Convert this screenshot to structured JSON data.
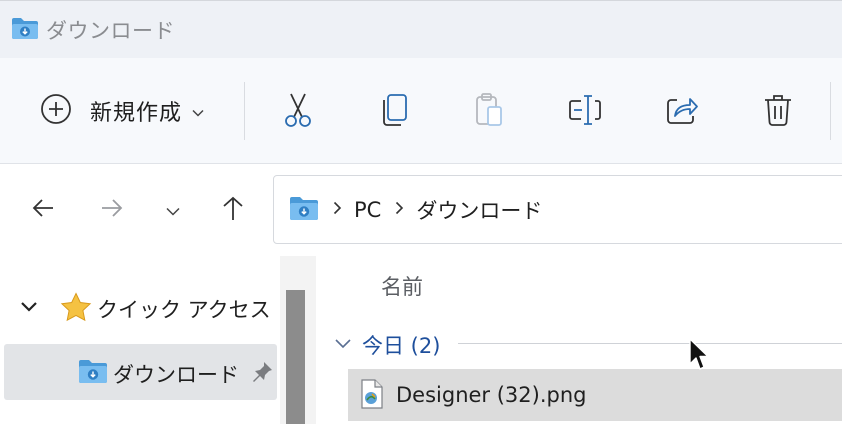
{
  "window": {
    "title": "ダウンロード",
    "icon": "downloads-folder-icon"
  },
  "commandbar": {
    "new_label": "新規作成",
    "tools": [
      {
        "name": "cut",
        "icon": "scissors-icon",
        "enabled": true
      },
      {
        "name": "copy",
        "icon": "copy-icon",
        "enabled": true
      },
      {
        "name": "paste",
        "icon": "clipboard-icon",
        "enabled": false
      },
      {
        "name": "rename",
        "icon": "rename-icon",
        "enabled": true
      },
      {
        "name": "share",
        "icon": "share-icon",
        "enabled": true
      },
      {
        "name": "delete",
        "icon": "trash-icon",
        "enabled": true
      }
    ]
  },
  "address": {
    "crumbs": [
      "PC",
      "ダウンロード"
    ]
  },
  "sidebar": {
    "quick_access_label": "クイック アクセス",
    "items": [
      {
        "label": "ダウンロード",
        "pinned": true,
        "selected": true
      }
    ]
  },
  "filelist": {
    "column_name": "名前",
    "group_label": "今日 (2)",
    "files": [
      {
        "name": "Designer (32).png",
        "selected": true
      }
    ]
  },
  "colors": {
    "accent": "#1e4f9c",
    "folder": "#5aa9e6",
    "selection": "#dcdcdc"
  }
}
